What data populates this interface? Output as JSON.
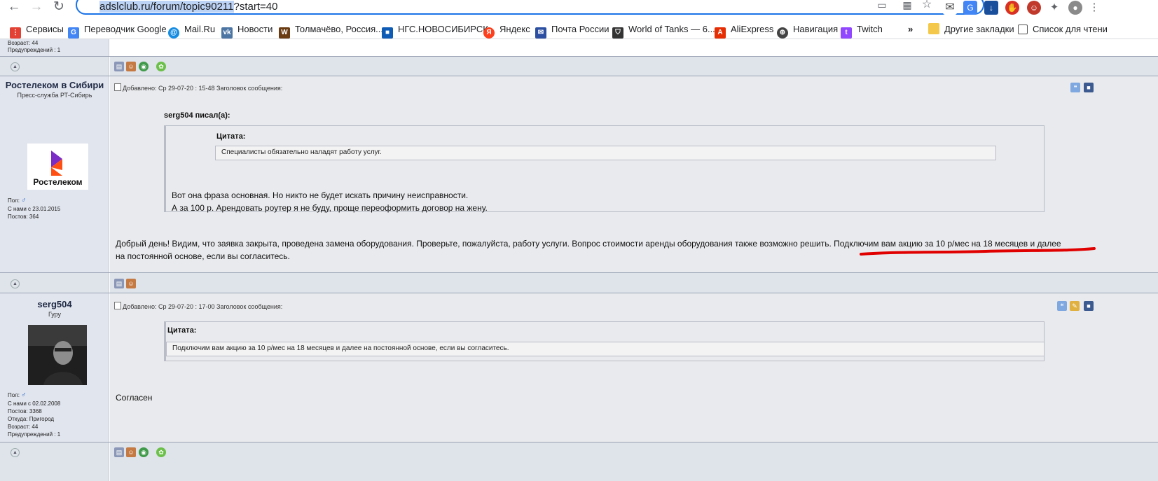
{
  "browser": {
    "url_highlighted": "adslclub.ru/forum/topic90211",
    "url_rest": "?start=40",
    "bookmarks": [
      {
        "label": "Сервисы",
        "color": "#e34133",
        "icon": "apps-icon"
      },
      {
        "label": "Переводчик Google",
        "color": "#4285f4",
        "icon": "google-translate-icon"
      },
      {
        "label": "Mail.Ru",
        "color": "#168de2",
        "icon": "mailru-icon"
      },
      {
        "label": "Новости",
        "color": "#4c75a3",
        "icon": "vk-icon"
      },
      {
        "label": "Толмачёво, Россия...",
        "color": "#6b3b12",
        "icon": "weather-icon"
      },
      {
        "label": "НГС.НОВОСИБИРСК",
        "color": "#0d5bb5",
        "icon": "ngs-icon"
      },
      {
        "label": "Яндекс",
        "color": "#fc3f1d",
        "icon": "yandex-icon"
      },
      {
        "label": "Почта России",
        "color": "#2c4fa1",
        "icon": "russian-post-icon"
      },
      {
        "label": "World of Tanks — 6...",
        "color": "#333333",
        "icon": "wot-icon"
      },
      {
        "label": "AliExpress",
        "color": "#e62e04",
        "icon": "aliexpress-icon"
      },
      {
        "label": "Навигация",
        "color": "#444444",
        "icon": "navigation-icon"
      },
      {
        "label": "Twitch",
        "color": "#9146ff",
        "icon": "twitch-icon"
      }
    ],
    "overflow_label": "»",
    "other_bookmarks": "Другие закладки",
    "reading_list": "Список для чтени"
  },
  "top_user": {
    "age": "Возраст: 44",
    "warnings": "Предупреждений : 1"
  },
  "posts": [
    {
      "author": "Ростелеком в Сибири",
      "rank": "Пресс-служба РТ-Сибирь",
      "avatar_text": "Ростелеком",
      "gender_label": "Пол:",
      "since": "С нами с 23.01.2015",
      "post_count": "Постов: 364",
      "meta": "Добавлено: Ср 29-07-20 : 15-48    Заголовок сообщения:",
      "quote_author": "serg504 писал(а):",
      "quote_title": "Цитата:",
      "inner_quote": "Специалисты обязательно наладят работу услуг.",
      "quote_line1": "Вот она фраза основная. Но никто не будет искать причину неисправности.",
      "quote_line2": "А за 100 р. Арендовать роутер я не буду, проще переоформить договор на жену.",
      "body_line1": "Добрый день! Видим, что заявка закрыта, проведена замена оборудования. Проверьте, пожалуйста, работу услуги. Вопрос стоимости аренды оборудования также возможно решить. Подключим вам акцию за 10 р/мес на 18 месяцев и далее",
      "body_line2": "на постоянной основе, если вы согласитесь."
    },
    {
      "author": "serg504",
      "rank": "Гуру",
      "gender_label": "Пол:",
      "since": "С нами с 02.02.2008",
      "post_count": "Постов: 3368",
      "location": "Откуда: Пригород",
      "age": "Возраст: 44",
      "warnings": "Предупреждений : 1",
      "meta": "Добавлено: Ср 29-07-20 : 17-00    Заголовок сообщения:",
      "quote_title": "Цитата:",
      "inner_quote": "Подключим вам акцию за 10 р/мес на 18 месяцев и далее на постоянной основе, если вы согласитесь.",
      "body": "Согласен"
    }
  ],
  "colors": {
    "underline": "#e00000",
    "accent": "#1a73e8"
  }
}
